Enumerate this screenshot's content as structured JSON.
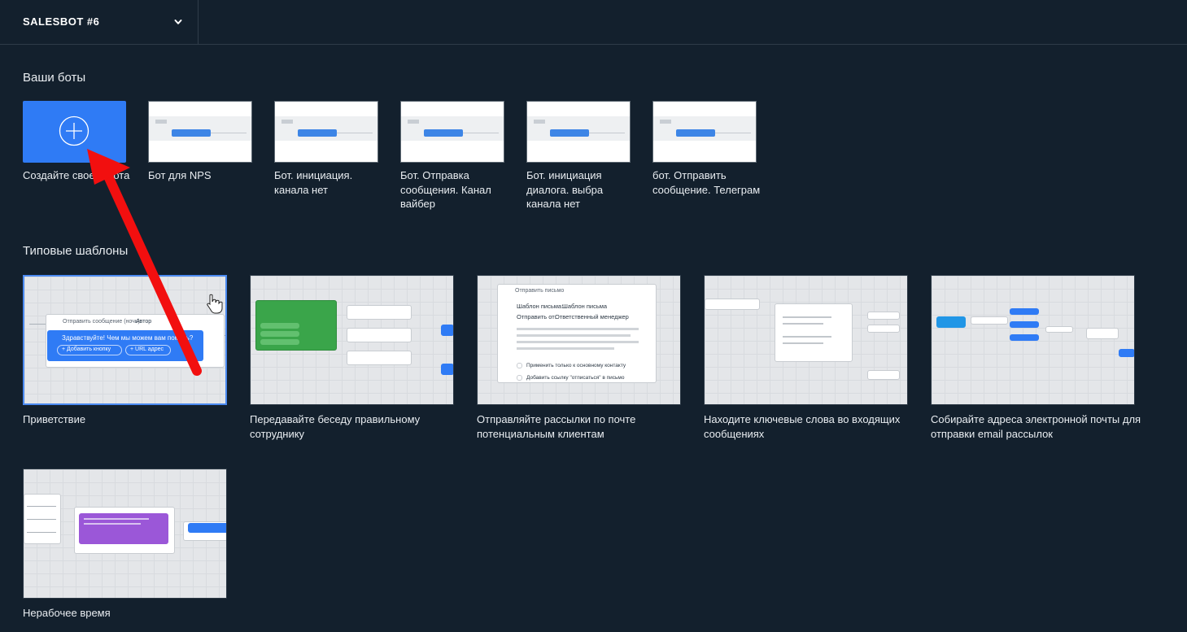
{
  "header": {
    "bot_selector_label": "SALESBOT #6",
    "chevron_icon": "chevron-down-icon"
  },
  "bots_section": {
    "title": "Ваши боты",
    "create": {
      "label": "Создайте своего бота",
      "icon": "plus-circle-icon",
      "color": "#2f7bf5"
    },
    "bots": [
      {
        "label": "Бот для NPS"
      },
      {
        "label": "Бот. инициация. канала нет"
      },
      {
        "label": "Бот. Отправка сообщения. Канал вайбер"
      },
      {
        "label": "Бот. инициация диалога. выбра канала нет"
      },
      {
        "label": "бот. Отправить сообщение. Телеграм"
      }
    ]
  },
  "templates_section": {
    "title": "Типовые шаблоны",
    "templates": [
      {
        "label": "Приветствие",
        "preview": {
          "step": "Отправить сообщение (ночь):",
          "step_value": "Автор",
          "message": "Здравствуйте! Чем мы можем вам помочь?",
          "add_button": "+ Добавить кнопку",
          "url_button": "+ URL адрес",
          "accent": "#2f7bf5"
        }
      },
      {
        "label": "Передавайте беседу правильному сотруднику",
        "preview": {
          "accent": "#3aa54a"
        }
      },
      {
        "label": "Отправляйте рассылки по почте потенциальным клиентам",
        "preview": {
          "step": "Отправить письмо",
          "template_label": "Шаблон письма:",
          "template_value": "Шаблон письма",
          "from_label": "Отправить от:",
          "from_value": "Ответственный менеджер",
          "option_1": "Применить только к основному контакту",
          "option_2": "Добавить ссылку \"отписаться\" в письмо"
        }
      },
      {
        "label": "Находите ключевые слова во входящих сообщениях",
        "preview": {
          "accent": "#2f7bf5"
        }
      },
      {
        "label": "Собирайте адреса электронной почты для отправки email рассылок",
        "preview": {
          "accent": "#2f7bf5"
        }
      },
      {
        "label": "Нерабочее время",
        "preview": {
          "accent": "#9b57d8"
        }
      }
    ]
  },
  "annotation": {
    "arrow_color": "#f20f0f",
    "cursor": "hand-pointer-icon"
  }
}
